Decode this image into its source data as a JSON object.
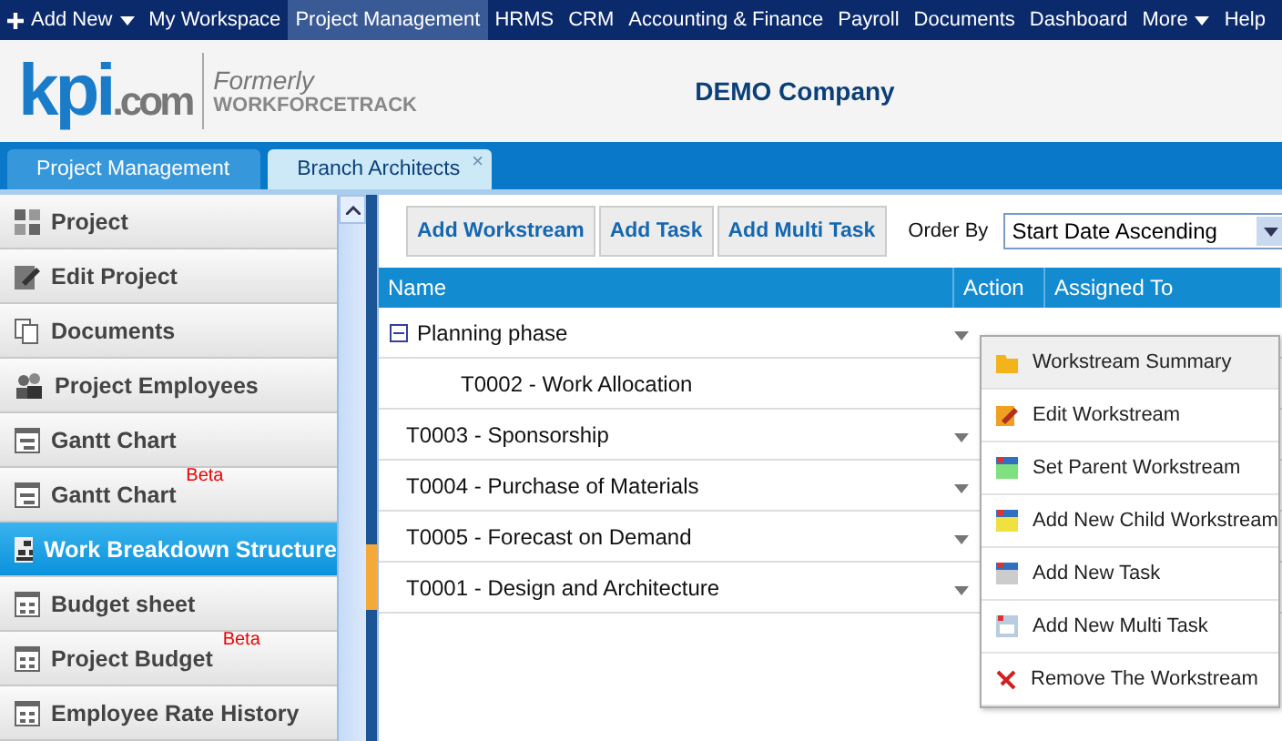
{
  "top_nav": [
    {
      "label": "Add New",
      "kind": "add",
      "selected": false
    },
    {
      "label": "My Workspace",
      "kind": "link",
      "selected": false
    },
    {
      "label": "Project Management",
      "kind": "link",
      "selected": true
    },
    {
      "label": "HRMS",
      "kind": "link",
      "selected": false
    },
    {
      "label": "CRM",
      "kind": "link",
      "selected": false
    },
    {
      "label": "Accounting & Finance",
      "kind": "link",
      "selected": false
    },
    {
      "label": "Payroll",
      "kind": "link",
      "selected": false
    },
    {
      "label": "Documents",
      "kind": "link",
      "selected": false
    },
    {
      "label": "Dashboard",
      "kind": "link",
      "selected": false
    },
    {
      "label": "More",
      "kind": "menu",
      "selected": false
    },
    {
      "label": "Help",
      "kind": "link",
      "selected": false
    }
  ],
  "brand": {
    "logo": "kpi",
    "logo_suffix": ".com",
    "formerly": "Formerly",
    "former_name": "WORKFORCETRACK",
    "company": "DEMO Company"
  },
  "tabs": [
    {
      "label": "Project Management",
      "selected": false
    },
    {
      "label": "Branch Architects",
      "selected": true,
      "close": "×"
    }
  ],
  "sidebar": {
    "items": [
      {
        "label": "Project",
        "kind": "grid",
        "selected": false
      },
      {
        "label": "Edit Project",
        "kind": "edit",
        "selected": false
      },
      {
        "label": "Documents",
        "kind": "docs",
        "selected": false
      },
      {
        "label": "Project Employees",
        "kind": "people",
        "selected": false
      },
      {
        "label": "Gantt Chart",
        "kind": "gantt",
        "selected": false
      },
      {
        "label": "Gantt Chart",
        "kind": "gantt",
        "selected": false,
        "badge": "Beta"
      },
      {
        "label": "Work Breakdown Structure",
        "kind": "wbs",
        "selected": true
      },
      {
        "label": "Budget sheet",
        "kind": "table",
        "selected": false
      },
      {
        "label": "Project Budget",
        "kind": "table",
        "selected": false,
        "badge": "Beta"
      },
      {
        "label": "Employee Rate History",
        "kind": "table",
        "selected": false
      }
    ]
  },
  "toolbar": {
    "buttons": [
      "Add Workstream",
      "Add Task",
      "Add Multi Task"
    ],
    "order_by": {
      "label": "Order By",
      "value": "Start Date Ascending"
    }
  },
  "table": {
    "columns": [
      "Name",
      "Action",
      "Assigned To"
    ],
    "rows": [
      {
        "name": "Planning phase",
        "expanded": true,
        "children": [
          {
            "name": "T0002 - Work Allocation"
          }
        ]
      },
      {
        "name": "T0003 - Sponsorship"
      },
      {
        "name": "T0004 - Purchase of Materials"
      },
      {
        "name": "T0005 - Forecast on Demand"
      },
      {
        "name": "T0001 - Design and Architecture"
      }
    ]
  },
  "context_menu": {
    "items": [
      {
        "label": "Workstream Summary",
        "kind": "folder",
        "selected": true
      },
      {
        "label": "Edit Workstream",
        "kind": "edit",
        "selected": false
      },
      {
        "label": "Set Parent Workstream",
        "kind": "parent",
        "selected": false
      },
      {
        "label": "Add New Child Workstream",
        "kind": "child",
        "selected": false
      },
      {
        "label": "Add New Task",
        "kind": "task",
        "selected": false
      },
      {
        "label": "Add New Multi Task",
        "kind": "multi",
        "selected": false
      },
      {
        "label": "Remove The Workstream",
        "kind": "remove",
        "selected": false
      }
    ]
  }
}
